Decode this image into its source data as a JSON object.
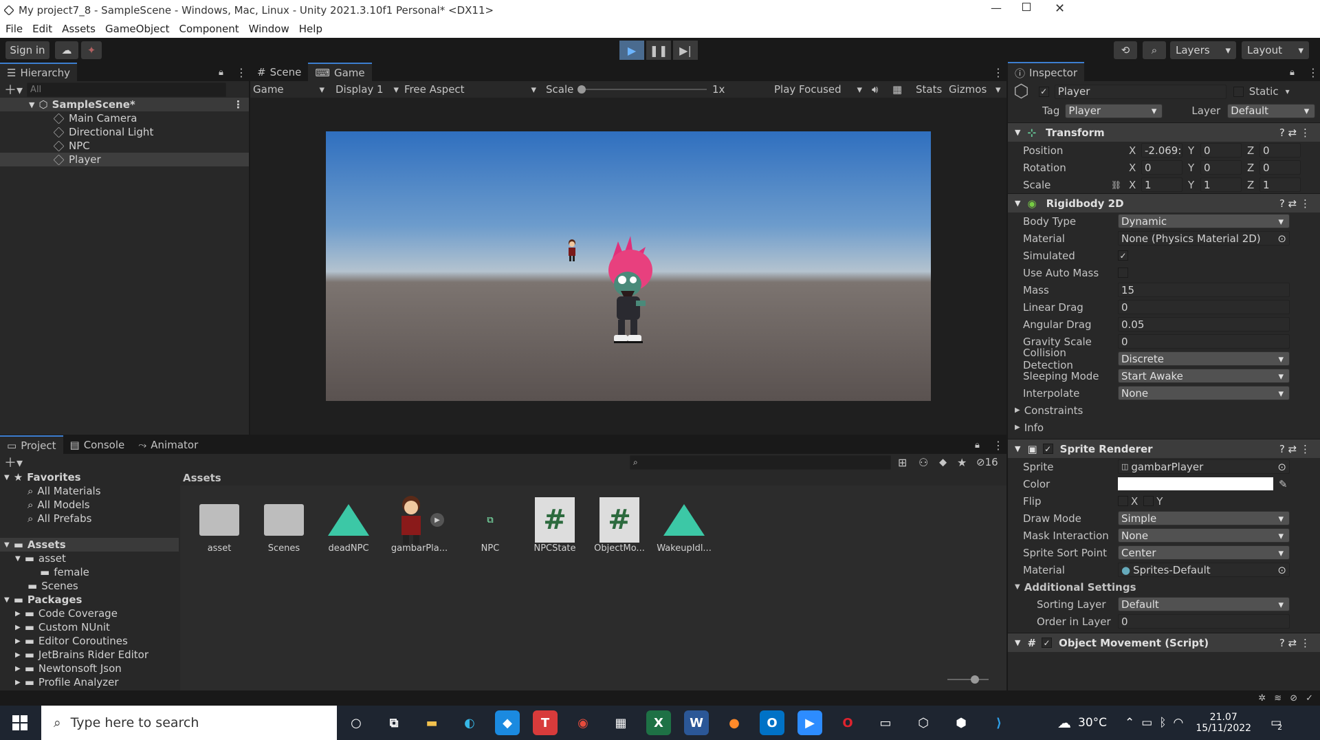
{
  "window": {
    "title": "My project7_8 - SampleScene - Windows, Mac, Linux - Unity 2021.3.10f1 Personal* <DX11>"
  },
  "menu": [
    "File",
    "Edit",
    "Assets",
    "GameObject",
    "Component",
    "Window",
    "Help"
  ],
  "toolbar": {
    "sign_in": "Sign in",
    "layers": "Layers",
    "layout": "Layout"
  },
  "hierarchy": {
    "tab": "Hierarchy",
    "search_placeholder": "All",
    "scene": "SampleScene*",
    "items": [
      "Main Camera",
      "Directional Light",
      "NPC",
      "Player"
    ]
  },
  "scene_tabs": {
    "scene": "Scene",
    "game": "Game"
  },
  "game_bar": {
    "mode": "Game",
    "display": "Display 1",
    "aspect": "Free Aspect",
    "scale_label": "Scale",
    "scale_value": "1x",
    "play_focused": "Play Focused",
    "stats": "Stats",
    "gizmos": "Gizmos"
  },
  "inspector": {
    "tab": "Inspector",
    "object_name": "Player",
    "static_label": "Static",
    "tag_label": "Tag",
    "tag_value": "Player",
    "layer_label": "Layer",
    "layer_value": "Default",
    "transform": {
      "title": "Transform",
      "rows": [
        {
          "label": "Position",
          "x": "-2.069:",
          "y": "0",
          "z": "0"
        },
        {
          "label": "Rotation",
          "x": "0",
          "y": "0",
          "z": "0"
        },
        {
          "label": "Scale",
          "x": "1",
          "y": "1",
          "z": "1"
        }
      ]
    },
    "rigidbody": {
      "title": "Rigidbody 2D",
      "body_type_label": "Body Type",
      "body_type": "Dynamic",
      "material_label": "Material",
      "material": "None (Physics Material 2D)",
      "simulated_label": "Simulated",
      "use_auto_mass_label": "Use Auto Mass",
      "mass_label": "Mass",
      "mass": "15",
      "linear_drag_label": "Linear Drag",
      "linear_drag": "0",
      "angular_drag_label": "Angular Drag",
      "angular_drag": "0.05",
      "gravity_scale_label": "Gravity Scale",
      "gravity_scale": "0",
      "collision_label": "Collision Detection",
      "collision": "Discrete",
      "sleeping_label": "Sleeping Mode",
      "sleeping": "Start Awake",
      "interpolate_label": "Interpolate",
      "interpolate": "None",
      "constraints": "Constraints",
      "info": "Info"
    },
    "sprite_renderer": {
      "title": "Sprite Renderer",
      "sprite_label": "Sprite",
      "sprite": "gambarPlayer",
      "color_label": "Color",
      "flip_label": "Flip",
      "flip_x": "X",
      "flip_y": "Y",
      "draw_mode_label": "Draw Mode",
      "draw_mode": "Simple",
      "mask_label": "Mask Interaction",
      "mask": "None",
      "sort_point_label": "Sprite Sort Point",
      "sort_point": "Center",
      "material_label": "Material",
      "material": "Sprites-Default",
      "additional": "Additional Settings",
      "sorting_layer_label": "Sorting Layer",
      "sorting_layer": "Default",
      "order_label": "Order in Layer",
      "order": "0"
    },
    "script": {
      "title": "Object Movement (Script)"
    }
  },
  "project": {
    "tabs": [
      "Project",
      "Console",
      "Animator"
    ],
    "hidden_count": "16",
    "favorites": "Favorites",
    "fav_items": [
      "All Materials",
      "All Models",
      "All Prefabs"
    ],
    "assets_label": "Assets",
    "asset_tree": [
      "asset",
      "female",
      "Scenes"
    ],
    "packages_label": "Packages",
    "packages": [
      "Code Coverage",
      "Custom NUnit",
      "Editor Coroutines",
      "JetBrains Rider Editor",
      "Newtonsoft Json",
      "Profile Analyzer"
    ],
    "breadcrumb": "Assets",
    "tiles": [
      "asset",
      "Scenes",
      "deadNPC",
      "gambarPla...",
      "NPC",
      "NPCState",
      "ObjectMo...",
      "WakeupIdl..."
    ]
  },
  "taskbar": {
    "search_placeholder": "Type here to search",
    "weather": "30°C",
    "time": "21.07",
    "date": "15/11/2022",
    "notifications": "2"
  }
}
